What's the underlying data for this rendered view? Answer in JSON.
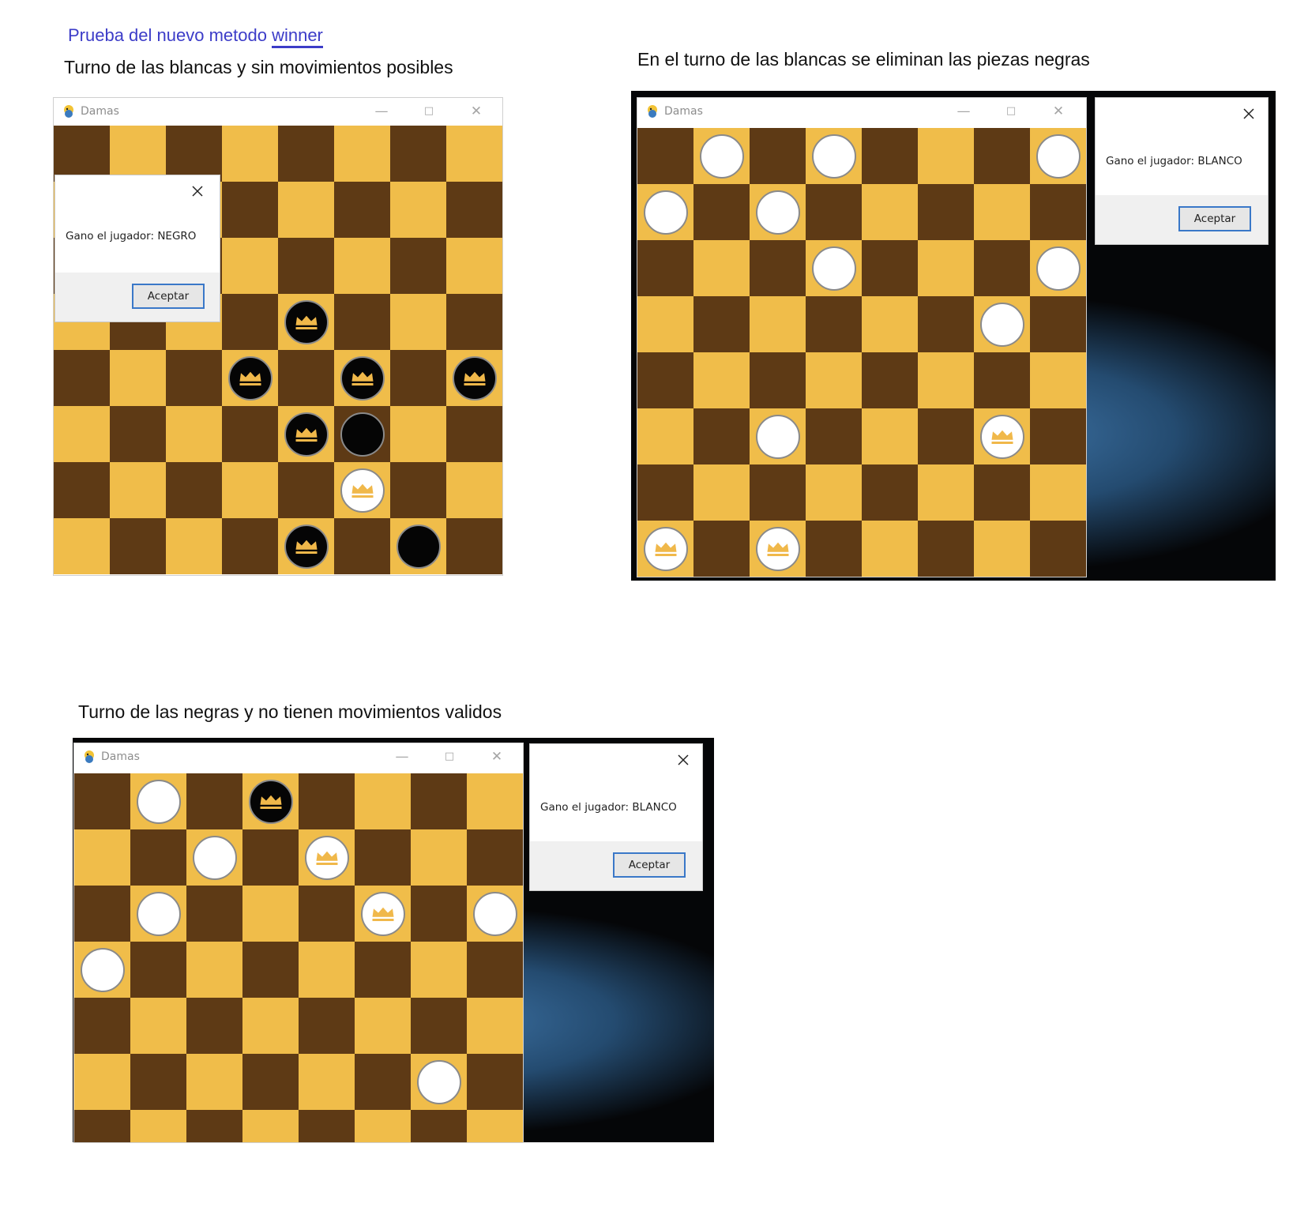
{
  "document": {
    "title_prefix": "Prueba del nuevo metodo ",
    "title_link": "winner",
    "captions": [
      "Turno de las blancas y sin movimientos posibles",
      "En el turno de las blancas se eliminan las piezas negras",
      "Turno de las negras y no tienen movimientos validos"
    ]
  },
  "colors": {
    "light_square": "#f0bd4a",
    "dark_square": "#5e3a15",
    "crown": "#f0b84a"
  },
  "windows": [
    {
      "title": "Damas",
      "rows": [
        "........",
        "........",
        "........",
        "....K...",
        "...K.K.K",
        "....Kb..",
        ".....Q..",
        "....K.b."
      ],
      "dialog": {
        "message": "Gano el jugador: NEGRO",
        "button": "Aceptar"
      }
    },
    {
      "title": "Damas",
      "rows": [
        ".w.w...w",
        "w.w.....",
        "...w...w",
        "......w.",
        "........",
        "..w...Q.",
        "........",
        "Q.Q....."
      ],
      "dialog": {
        "message": "Gano el jugador: BLANCO",
        "button": "Aceptar"
      }
    },
    {
      "title": "Damas",
      "rows": [
        ".w.K....",
        "..w.Q...",
        ".w...Q.w",
        "w.......",
        "........",
        "......w.",
        "........"
      ],
      "dialog": {
        "message": "Gano el jugador: BLANCO",
        "button": "Aceptar"
      }
    }
  ]
}
